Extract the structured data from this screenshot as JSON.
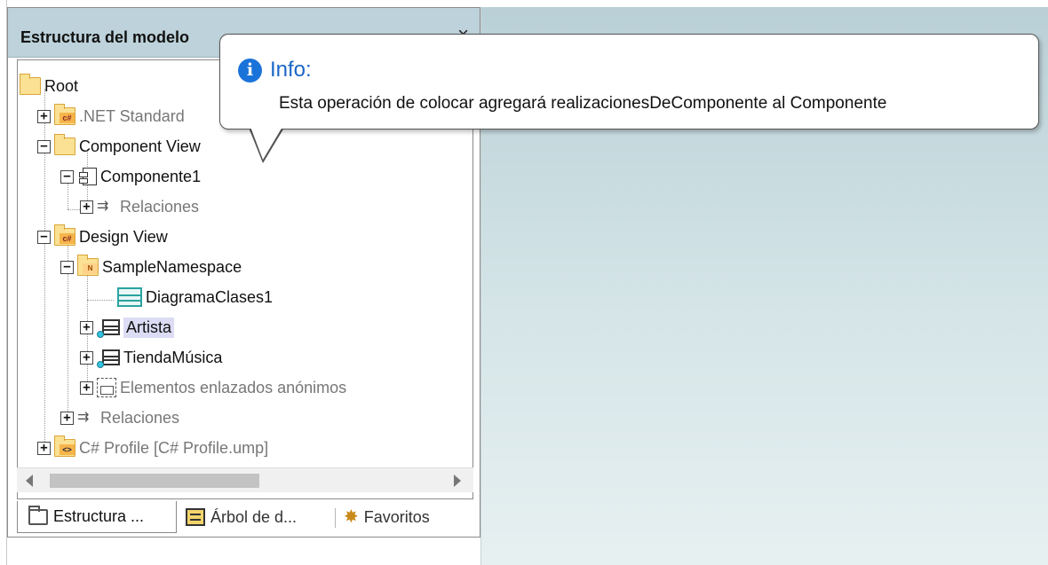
{
  "panel": {
    "title": "Estructura del modelo",
    "close_glyph": "×"
  },
  "tree": {
    "items": [
      {
        "label": "Root",
        "icon": "folder-icon",
        "muted": false
      },
      {
        "label": ".NET Standard",
        "icon": "csharp-folder-icon",
        "muted": true
      },
      {
        "label": "Component View",
        "icon": "folder-icon",
        "muted": false
      },
      {
        "label": "Componente1",
        "icon": "component-icon",
        "muted": false
      },
      {
        "label": "Relaciones",
        "icon": "relations-icon",
        "muted": true
      },
      {
        "label": "Design View",
        "icon": "csharp-folder-icon",
        "muted": false
      },
      {
        "label": "SampleNamespace",
        "icon": "namespace-folder-icon",
        "muted": false
      },
      {
        "label": "DiagramaClases1",
        "icon": "class-diagram-icon",
        "muted": false
      },
      {
        "label": "Artista",
        "icon": "class-icon",
        "muted": false,
        "selected": true
      },
      {
        "label": "TiendaMúsica",
        "icon": "class-icon",
        "muted": false
      },
      {
        "label": "Elementos enlazados anónimos",
        "icon": "anonymous-elements-icon",
        "muted": true
      },
      {
        "label": "Relaciones",
        "icon": "relations-icon",
        "muted": true
      },
      {
        "label": "C# Profile [C# Profile.ump]",
        "icon": "profile-folder-icon",
        "muted": true
      }
    ],
    "expanders": {
      "plus": "+",
      "minus": "−"
    },
    "badges": {
      "cs": "c#",
      "ns": "N",
      "prof": "<>"
    }
  },
  "tabs": [
    {
      "label": "Estructura ...",
      "icon": "folder-outline-icon",
      "active": true
    },
    {
      "label": "Árbol de d...",
      "icon": "diagram-tree-icon",
      "active": false
    },
    {
      "label": "Favoritos",
      "icon": "favorites-icon",
      "active": false
    }
  ],
  "tooltip": {
    "title": "Info:",
    "message": "Esta operación de colocar agregará realizacionesDeComponente al Componente",
    "icon": "info-icon"
  }
}
